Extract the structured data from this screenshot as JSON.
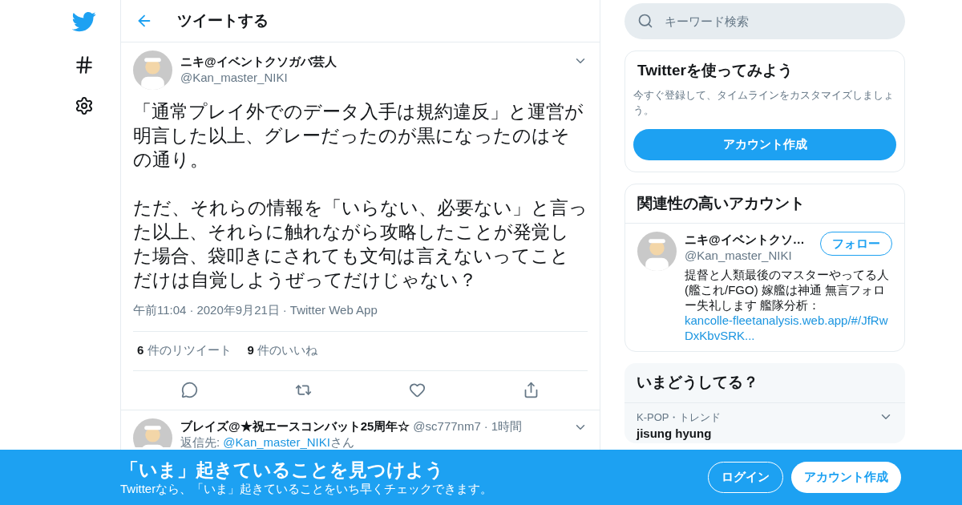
{
  "nav": {
    "items": [
      {
        "kind": "logo"
      },
      {
        "kind": "hashtag"
      },
      {
        "kind": "settings"
      }
    ]
  },
  "header": {
    "title": "ツイートする"
  },
  "tweet": {
    "name": "ニキ@イベントクソガバ芸人",
    "handle": "@Kan_master_NIKI",
    "paragraphs": [
      "「通常プレイ外でのデータ入手は規約違反」と運営が明言した以上、グレーだったのが黒になったのはその通り。",
      "ただ、それらの情報を「いらない、必要ない」と言った以上、それらに触れながら攻略したことが発覚した場合、袋叩きにされても文句は言えないってことだけは自覚しようぜってだけじゃない？"
    ],
    "meta": [
      "午前11:04",
      "2020年9月21日",
      "Twitter Web App"
    ],
    "separator": "·",
    "stats": [
      {
        "count": "6",
        "label": "件のリツイート"
      },
      {
        "count": "9",
        "label": "件のいいね"
      }
    ],
    "actions": [
      {
        "kind": "reply"
      },
      {
        "kind": "retweet"
      },
      {
        "kind": "like"
      },
      {
        "kind": "share"
      }
    ]
  },
  "reply": {
    "name": "ブレイズ@★祝エースコンバット25周年☆",
    "handle": "@sc777nm7",
    "separator": "·",
    "time": "1時間",
    "reply_to_label": "返信先: ",
    "reply_to": "@Kan_master_NIKI",
    "reply_to_suffix": "さん"
  },
  "search": {
    "placeholder": "キーワード検索"
  },
  "signup_card": {
    "title": "Twitterを使ってみよう",
    "text": "今すぐ登録して、タイムラインをカスタマイズしましょう。",
    "button": "アカウント作成"
  },
  "related": {
    "title": "関連性の高いアカウント",
    "accounts": [
      {
        "name": "ニキ@イベントクソ…",
        "handle": "@Kan_master_NIKI",
        "follow": "フォロー",
        "bio": "提督と人類最後のマスターやってる人(艦これ/FGO) 嫁艦は神通 無言フォロー失礼します 艦隊分析：",
        "link": "kancolle-fleetanalysis.web.app/#/JfRwDxKbvSRK..."
      }
    ]
  },
  "trends": {
    "title": "いまどうしてる？",
    "items": [
      {
        "context": "K-POP・トレンド",
        "name": "jisung hyung"
      }
    ]
  },
  "banner": {
    "title": "「いま」起きていることを見つけよう",
    "subtitle": "Twitterなら、「いま」起きていることをいち早くチェックできます。",
    "login": "ログイン",
    "signup": "アカウント作成"
  }
}
